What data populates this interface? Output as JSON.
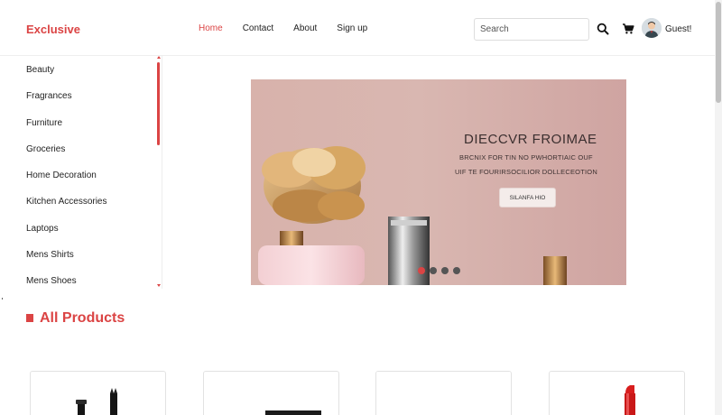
{
  "header": {
    "logo": "Exclusive",
    "nav": [
      {
        "label": "Home",
        "active": true
      },
      {
        "label": "Contact",
        "active": false
      },
      {
        "label": "About",
        "active": false
      },
      {
        "label": "Sign up",
        "active": false
      }
    ],
    "search_placeholder": "Search",
    "icons": [
      "search-icon",
      "cart-icon",
      "avatar"
    ],
    "user_label": "Guest!"
  },
  "sidebar": {
    "categories": [
      "Beauty",
      "Fragrances",
      "Furniture",
      "Groceries",
      "Home Decoration",
      "Kitchen Accessories",
      "Laptops",
      "Mens Shirts",
      "Mens Shoes"
    ]
  },
  "hero": {
    "title": "DIECCVR FROIMAE",
    "subtitle_1": "BRCNIX FOR TIN NO PWHORTIAIC OUF",
    "subtitle_2": "UIF TE FOURIRSOCILIOR DOLLECEOTION",
    "button_label": "SILANFA HIO",
    "slides_total": 4,
    "active_slide": 1
  },
  "products_section": {
    "title": "All Products"
  },
  "products": [
    {
      "image": "mascara"
    },
    {
      "image": "palette"
    },
    {
      "image": "blank"
    },
    {
      "image": "lipstick"
    }
  ],
  "colors": {
    "accent": "#db4444",
    "text": "#222222",
    "border": "#e2e2e2"
  }
}
